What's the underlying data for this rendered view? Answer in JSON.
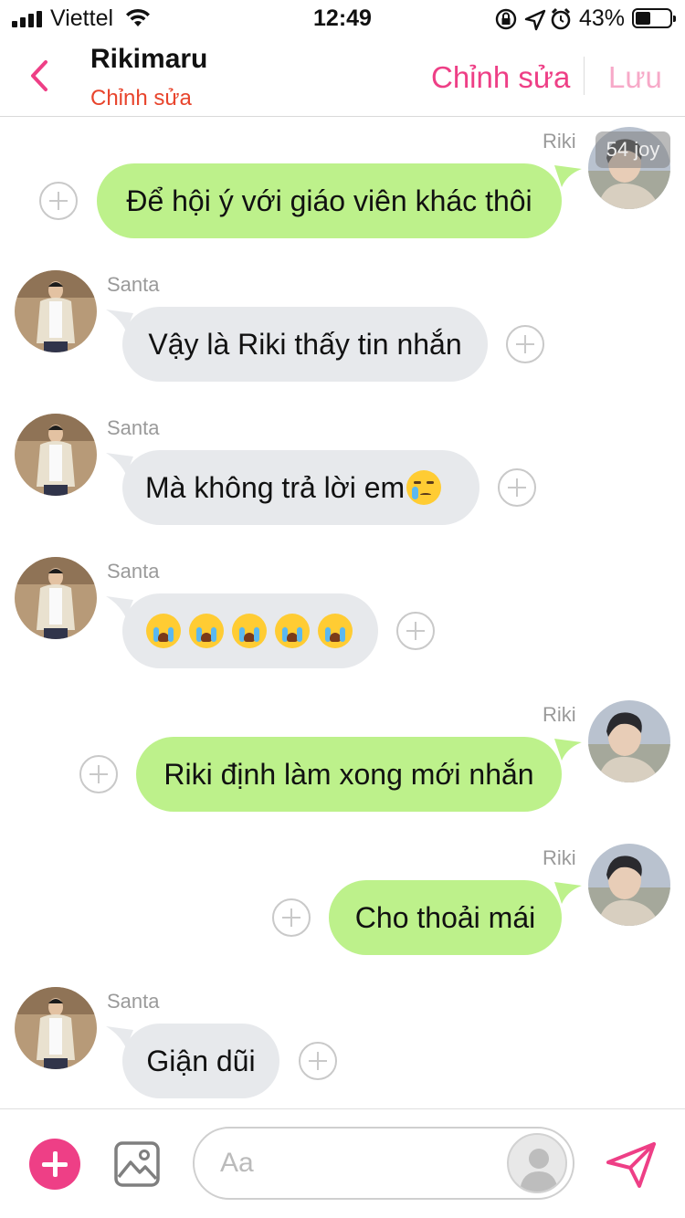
{
  "status_bar": {
    "carrier": "Viettel",
    "time": "12:49",
    "battery_percent": "43%",
    "battery_level": 0.43,
    "icons": [
      "signal-icon",
      "wifi-icon",
      "lock-rotation-icon",
      "location-icon",
      "alarm-icon",
      "battery-icon"
    ]
  },
  "header": {
    "title": "Rikimaru",
    "subtitle": "Chỉnh sửa",
    "edit_label": "Chỉnh sửa",
    "save_label": "Lưu",
    "back_icon": "chevron-left-icon"
  },
  "colors": {
    "accent": "#ee3f86",
    "subtitle_red": "#e8442c",
    "save_disabled": "#f7a9c8",
    "outgoing_bubble": "#bdf18b",
    "incoming_bubble": "#e7e9ec"
  },
  "messages": [
    {
      "sender": "Riki",
      "direction": "out",
      "text": "Để hội ý với giáo viên khác thôi",
      "badge": "54 joy"
    },
    {
      "sender": "Santa",
      "direction": "in",
      "text": "Vậy là Riki thấy tin nhắn"
    },
    {
      "sender": "Santa",
      "direction": "in",
      "text": "Mà không trả lời em",
      "emoji": "crying-face-emoji"
    },
    {
      "sender": "Santa",
      "direction": "in",
      "text": "",
      "emoji": "loudly-crying-face-emoji",
      "emoji_count": 5
    },
    {
      "sender": "Riki",
      "direction": "out",
      "text": "Riki định làm xong mới nhắn"
    },
    {
      "sender": "Riki",
      "direction": "out",
      "text": "Cho thoải mái"
    },
    {
      "sender": "Santa",
      "direction": "in",
      "text": "Giận dũi"
    }
  ],
  "input_bar": {
    "placeholder": "Aa",
    "value": "",
    "icons": [
      "plus-icon",
      "image-icon",
      "sticker-avatar-icon",
      "send-icon"
    ]
  }
}
